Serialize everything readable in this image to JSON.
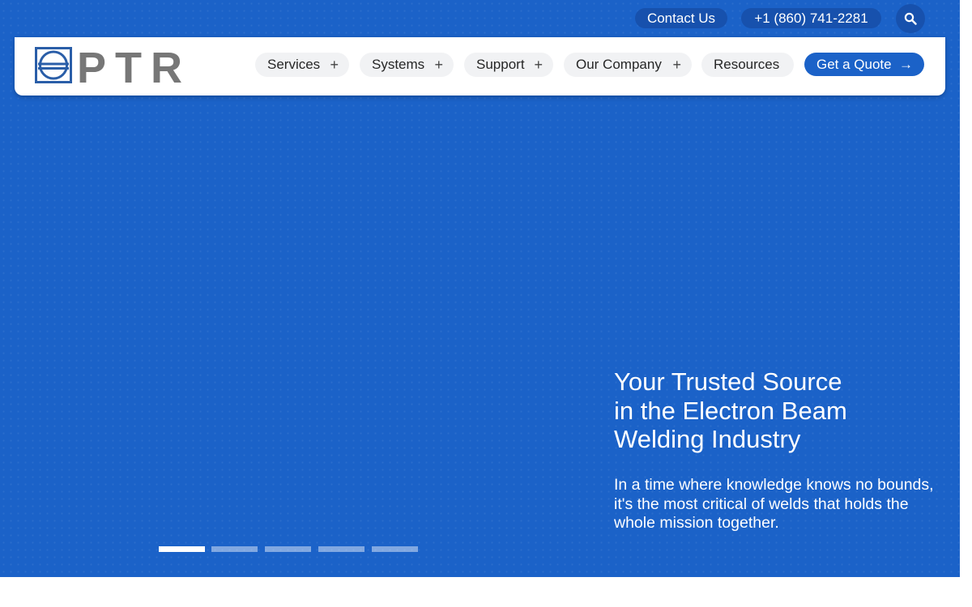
{
  "topbar": {
    "contact_label": "Contact Us",
    "phone_label": "+1 (860) 741-2281",
    "search_icon": "search-icon"
  },
  "logo": {
    "text": "PTR",
    "icon": "ptr-logo-mark"
  },
  "nav": {
    "items": [
      {
        "label": "Services",
        "has_submenu": true
      },
      {
        "label": "Systems",
        "has_submenu": true
      },
      {
        "label": "Support",
        "has_submenu": true
      },
      {
        "label": "Our Company",
        "has_submenu": true
      },
      {
        "label": "Resources",
        "has_submenu": false
      }
    ],
    "submenu_icon": "+",
    "cta_label": "Get a Quote",
    "cta_icon": "→"
  },
  "hero": {
    "headline_line1": "Your Trusted Source",
    "headline_line2": "in the Electron Beam",
    "headline_line3": "Welding Industry",
    "subtext": "In a time where knowledge knows no bounds, it's the most critical of welds that holds the whole mission together.",
    "slides_total": 5,
    "active_slide": 1
  },
  "colors": {
    "brand_blue": "#1b62c8",
    "pill_dark_blue": "#1751ad",
    "logo_blue": "#2a5ea8",
    "logo_gray": "#777777"
  }
}
